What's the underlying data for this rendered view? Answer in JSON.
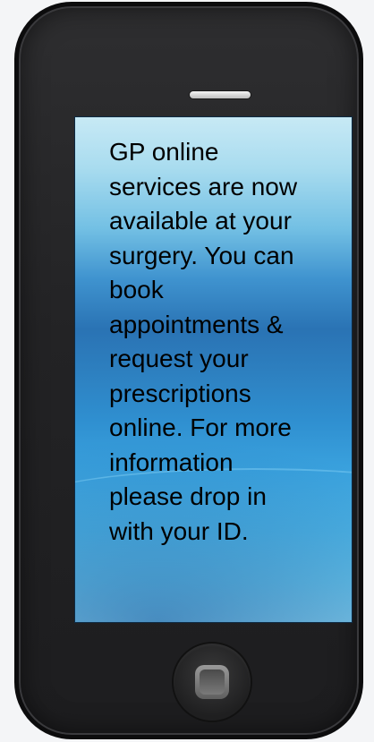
{
  "screen": {
    "message": "GP online\nservices are now\navailable at your\nsurgery. You can\nbook\nappointments &\nrequest your\nprescriptions\nonline. For more\ninformation\nplease  drop in\nwith your ID."
  },
  "icons": {
    "speaker": "speaker-grille-icon",
    "home_button": "home-button-icon"
  },
  "colors": {
    "phone_body": "#232325",
    "screen_top": "#c7e9f5",
    "screen_mid": "#2a73b4",
    "screen_bottom": "#88d6f2",
    "text": "#000000"
  }
}
